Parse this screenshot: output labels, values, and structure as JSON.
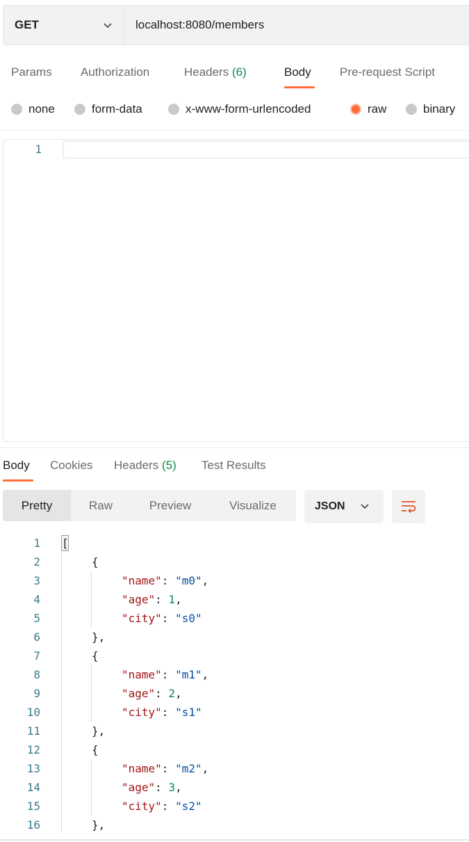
{
  "request": {
    "method": "GET",
    "url": "localhost:8080/members"
  },
  "request_tabs": [
    {
      "label": "Params"
    },
    {
      "label": "Authorization"
    },
    {
      "label": "Headers",
      "count": "(6)"
    },
    {
      "label": "Body",
      "active": true
    },
    {
      "label": "Pre-request Script"
    }
  ],
  "body_types": [
    {
      "label": "none",
      "selected": false
    },
    {
      "label": "form-data",
      "selected": false
    },
    {
      "label": "x-www-form-urlencoded",
      "selected": false
    },
    {
      "label": "raw",
      "selected": true
    },
    {
      "label": "binary",
      "selected": false
    }
  ],
  "request_editor": {
    "line_numbers": [
      "1"
    ]
  },
  "response_tabs": [
    {
      "label": "Body",
      "active": true
    },
    {
      "label": "Cookies"
    },
    {
      "label": "Headers",
      "count": "(5)"
    },
    {
      "label": "Test Results"
    }
  ],
  "view_modes": [
    "Pretty",
    "Raw",
    "Preview",
    "Visualize"
  ],
  "active_view_mode": "Pretty",
  "format": "JSON",
  "response_lines": [
    {
      "n": "1",
      "indent": 0,
      "tokens": [
        [
          "punc",
          "["
        ]
      ]
    },
    {
      "n": "2",
      "indent": 1,
      "tokens": [
        [
          "punc",
          "{"
        ]
      ]
    },
    {
      "n": "3",
      "indent": 2,
      "tokens": [
        [
          "key",
          "\"name\""
        ],
        [
          "punc",
          ": "
        ],
        [
          "str",
          "\"m0\""
        ],
        [
          "punc",
          ","
        ]
      ]
    },
    {
      "n": "4",
      "indent": 2,
      "tokens": [
        [
          "key",
          "\"age\""
        ],
        [
          "punc",
          ": "
        ],
        [
          "num",
          "1"
        ],
        [
          "punc",
          ","
        ]
      ]
    },
    {
      "n": "5",
      "indent": 2,
      "tokens": [
        [
          "key",
          "\"city\""
        ],
        [
          "punc",
          ": "
        ],
        [
          "str",
          "\"s0\""
        ]
      ]
    },
    {
      "n": "6",
      "indent": 1,
      "tokens": [
        [
          "punc",
          "},"
        ]
      ]
    },
    {
      "n": "7",
      "indent": 1,
      "tokens": [
        [
          "punc",
          "{"
        ]
      ]
    },
    {
      "n": "8",
      "indent": 2,
      "tokens": [
        [
          "key",
          "\"name\""
        ],
        [
          "punc",
          ": "
        ],
        [
          "str",
          "\"m1\""
        ],
        [
          "punc",
          ","
        ]
      ]
    },
    {
      "n": "9",
      "indent": 2,
      "tokens": [
        [
          "key",
          "\"age\""
        ],
        [
          "punc",
          ": "
        ],
        [
          "num",
          "2"
        ],
        [
          "punc",
          ","
        ]
      ]
    },
    {
      "n": "10",
      "indent": 2,
      "tokens": [
        [
          "key",
          "\"city\""
        ],
        [
          "punc",
          ": "
        ],
        [
          "str",
          "\"s1\""
        ]
      ]
    },
    {
      "n": "11",
      "indent": 1,
      "tokens": [
        [
          "punc",
          "},"
        ]
      ]
    },
    {
      "n": "12",
      "indent": 1,
      "tokens": [
        [
          "punc",
          "{"
        ]
      ]
    },
    {
      "n": "13",
      "indent": 2,
      "tokens": [
        [
          "key",
          "\"name\""
        ],
        [
          "punc",
          ": "
        ],
        [
          "str",
          "\"m2\""
        ],
        [
          "punc",
          ","
        ]
      ]
    },
    {
      "n": "14",
      "indent": 2,
      "tokens": [
        [
          "key",
          "\"age\""
        ],
        [
          "punc",
          ": "
        ],
        [
          "num",
          "3"
        ],
        [
          "punc",
          ","
        ]
      ]
    },
    {
      "n": "15",
      "indent": 2,
      "tokens": [
        [
          "key",
          "\"city\""
        ],
        [
          "punc",
          ": "
        ],
        [
          "str",
          "\"s2\""
        ]
      ]
    },
    {
      "n": "16",
      "indent": 1,
      "tokens": [
        [
          "punc",
          "},"
        ]
      ]
    }
  ],
  "colors": {
    "accent": "#ff6c37",
    "count_green": "#0e8a4a",
    "json_key": "#a31515",
    "json_string": "#0451a5",
    "json_number": "#098658"
  }
}
